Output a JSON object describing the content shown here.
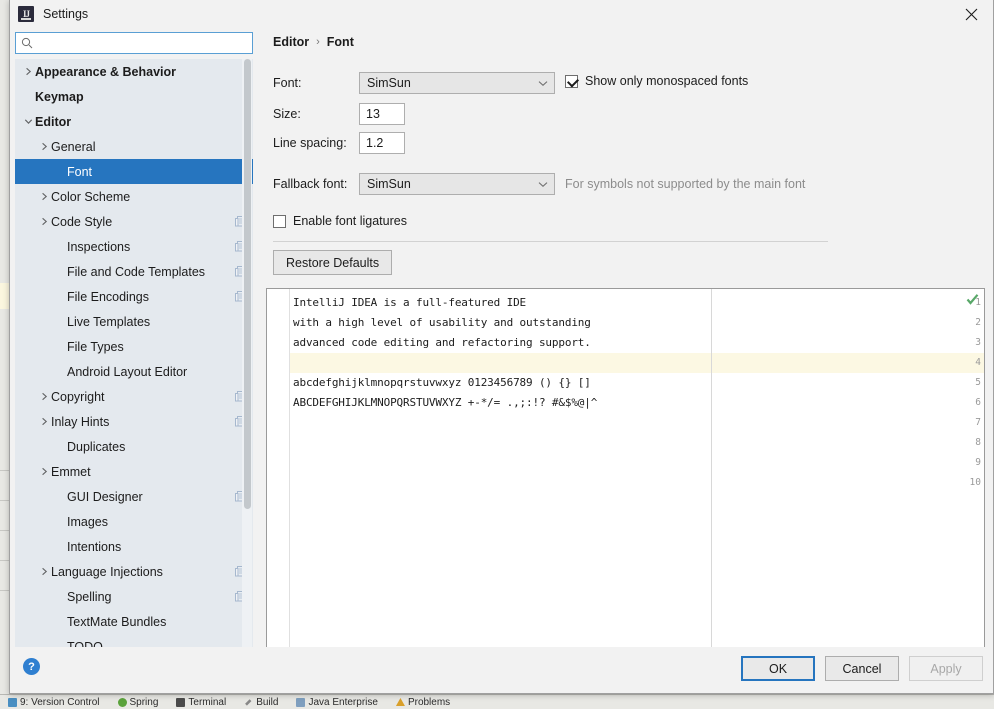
{
  "window": {
    "title": "Settings",
    "app_icon": "intellij-idea-icon",
    "close_icon": "close-icon"
  },
  "search": {
    "value": "",
    "placeholder": "",
    "icon": "search-icon"
  },
  "tree": {
    "items": [
      {
        "label": "Appearance & Behavior",
        "level": 0,
        "arrow": "collapsed",
        "bold": true,
        "dup": false,
        "selected": false
      },
      {
        "label": "Keymap",
        "level": 0,
        "arrow": "none",
        "bold": true,
        "dup": false,
        "selected": false
      },
      {
        "label": "Editor",
        "level": 0,
        "arrow": "expanded",
        "bold": true,
        "dup": false,
        "selected": false
      },
      {
        "label": "General",
        "level": 1,
        "arrow": "collapsed",
        "bold": false,
        "dup": false,
        "selected": false
      },
      {
        "label": "Font",
        "level": 2,
        "arrow": "none",
        "bold": false,
        "dup": false,
        "selected": true
      },
      {
        "label": "Color Scheme",
        "level": 1,
        "arrow": "collapsed",
        "bold": false,
        "dup": false,
        "selected": false
      },
      {
        "label": "Code Style",
        "level": 1,
        "arrow": "collapsed",
        "bold": false,
        "dup": true,
        "selected": false
      },
      {
        "label": "Inspections",
        "level": 2,
        "arrow": "none",
        "bold": false,
        "dup": true,
        "selected": false
      },
      {
        "label": "File and Code Templates",
        "level": 2,
        "arrow": "none",
        "bold": false,
        "dup": true,
        "selected": false
      },
      {
        "label": "File Encodings",
        "level": 2,
        "arrow": "none",
        "bold": false,
        "dup": true,
        "selected": false
      },
      {
        "label": "Live Templates",
        "level": 2,
        "arrow": "none",
        "bold": false,
        "dup": false,
        "selected": false
      },
      {
        "label": "File Types",
        "level": 2,
        "arrow": "none",
        "bold": false,
        "dup": false,
        "selected": false
      },
      {
        "label": "Android Layout Editor",
        "level": 2,
        "arrow": "none",
        "bold": false,
        "dup": false,
        "selected": false
      },
      {
        "label": "Copyright",
        "level": 1,
        "arrow": "collapsed",
        "bold": false,
        "dup": true,
        "selected": false
      },
      {
        "label": "Inlay Hints",
        "level": 1,
        "arrow": "collapsed",
        "bold": false,
        "dup": true,
        "selected": false
      },
      {
        "label": "Duplicates",
        "level": 2,
        "arrow": "none",
        "bold": false,
        "dup": false,
        "selected": false
      },
      {
        "label": "Emmet",
        "level": 1,
        "arrow": "collapsed",
        "bold": false,
        "dup": false,
        "selected": false
      },
      {
        "label": "GUI Designer",
        "level": 2,
        "arrow": "none",
        "bold": false,
        "dup": true,
        "selected": false
      },
      {
        "label": "Images",
        "level": 2,
        "arrow": "none",
        "bold": false,
        "dup": false,
        "selected": false
      },
      {
        "label": "Intentions",
        "level": 2,
        "arrow": "none",
        "bold": false,
        "dup": false,
        "selected": false
      },
      {
        "label": "Language Injections",
        "level": 1,
        "arrow": "collapsed",
        "bold": false,
        "dup": true,
        "selected": false
      },
      {
        "label": "Spelling",
        "level": 2,
        "arrow": "none",
        "bold": false,
        "dup": true,
        "selected": false
      },
      {
        "label": "TextMate Bundles",
        "level": 2,
        "arrow": "none",
        "bold": false,
        "dup": false,
        "selected": false
      },
      {
        "label": "TODO",
        "level": 2,
        "arrow": "none",
        "bold": false,
        "dup": false,
        "selected": false
      }
    ]
  },
  "breadcrumb": {
    "parent": "Editor",
    "separator": "›",
    "current": "Font"
  },
  "form": {
    "font_label": "Font:",
    "font_value": "SimSun",
    "monospaced_checkbox": {
      "label": "Show only monospaced fonts",
      "checked": true
    },
    "size_label": "Size:",
    "size_value": "13",
    "line_spacing_label": "Line spacing:",
    "line_spacing_value": "1.2",
    "fallback_label": "Fallback font:",
    "fallback_value": "SimSun",
    "fallback_hint": "For symbols not supported by the main font",
    "ligatures_checkbox": {
      "label": "Enable font ligatures",
      "checked": false
    },
    "restore_defaults_label": "Restore Defaults"
  },
  "preview": {
    "gutter_numbers": [
      "1",
      "2",
      "3",
      "4",
      "5",
      "6",
      "7",
      "8",
      "9",
      "10"
    ],
    "caret_line": 4,
    "ok_badge_icon": "green-check-icon",
    "lines": [
      "IntelliJ IDEA is a full-featured IDE",
      "with a high level of usability and outstanding",
      "advanced code editing and refactoring support.",
      "",
      "abcdefghijklmnopqrstuvwxyz 0123456789 () {} []",
      "ABCDEFGHIJKLMNOPQRSTUVWXYZ +-*/= .,;:!? #&$%@|^"
    ]
  },
  "footer": {
    "help_label": "?",
    "ok_label": "OK",
    "cancel_label": "Cancel",
    "apply_label": "Apply"
  },
  "ide_statusbar": {
    "items": [
      {
        "label": "9: Version Control",
        "icon": "version-control-icon"
      },
      {
        "label": "Spring",
        "icon": "spring-icon"
      },
      {
        "label": "Terminal",
        "icon": "terminal-icon"
      },
      {
        "label": "Build",
        "icon": "build-icon"
      },
      {
        "label": "Java Enterprise",
        "icon": "java-enterprise-icon"
      },
      {
        "label": "Problems",
        "icon": "problems-icon"
      }
    ]
  },
  "colors": {
    "selection": "#2675bf",
    "dialog_bg": "#f2f2f2",
    "tree_bg": "#e4e9ee",
    "caret_row": "#fcf8e3",
    "hint_text": "#8c8c8c"
  }
}
